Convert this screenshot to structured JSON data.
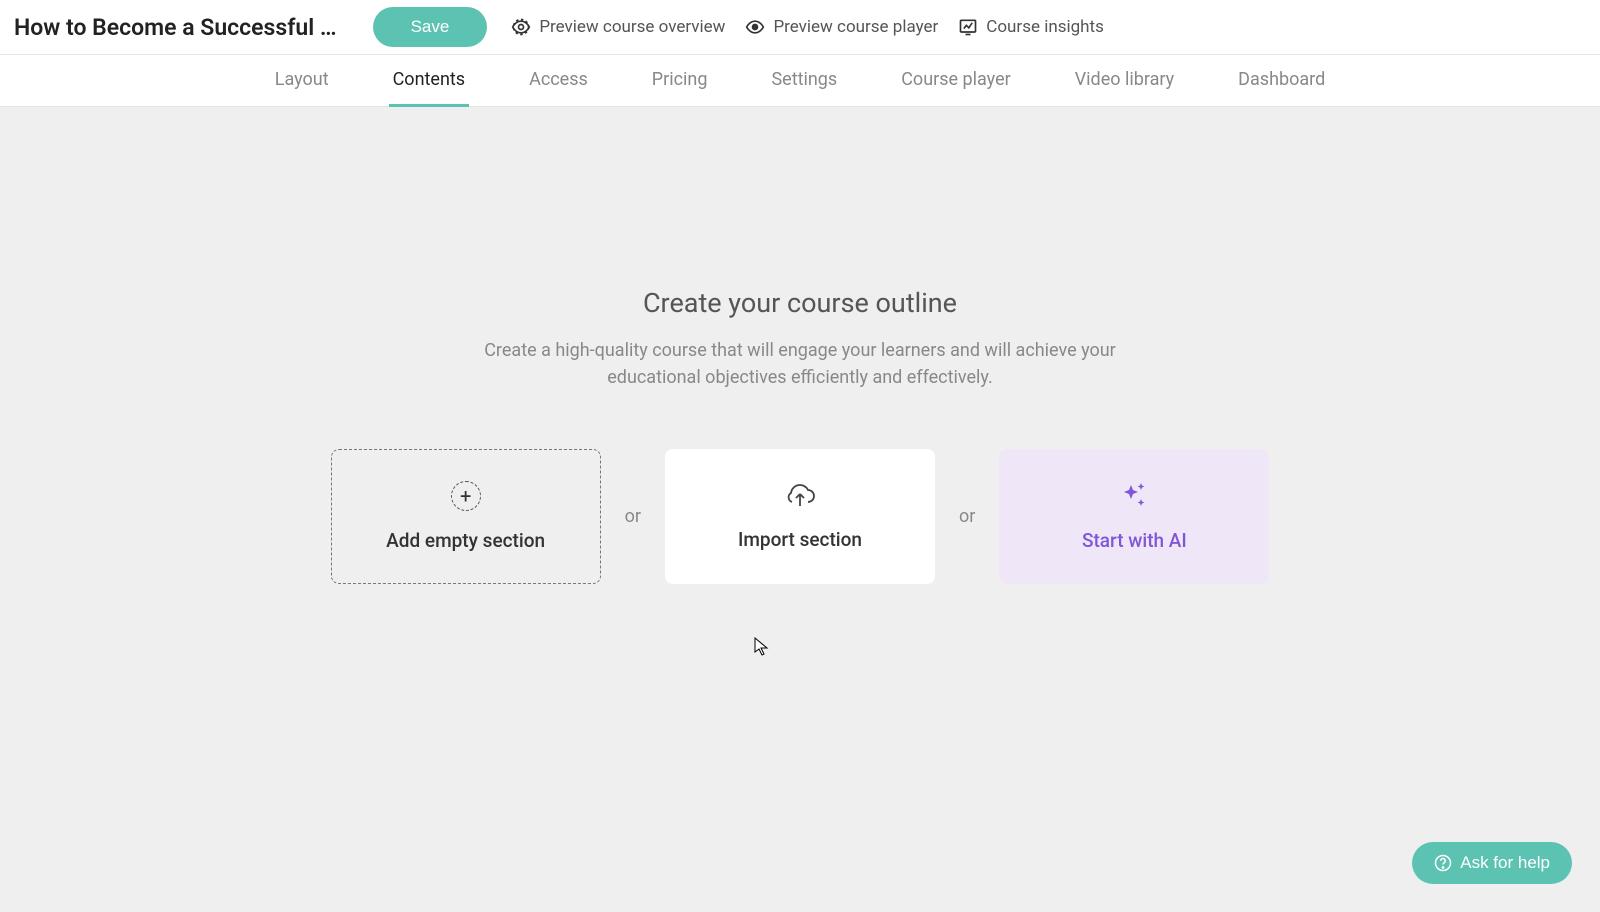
{
  "header": {
    "course_title": "How to Become a Successful …",
    "save_label": "Save",
    "links": {
      "preview_overview": "Preview course overview",
      "preview_player": "Preview course player",
      "course_insights": "Course insights"
    }
  },
  "tabs": {
    "layout": "Layout",
    "contents": "Contents",
    "access": "Access",
    "pricing": "Pricing",
    "settings": "Settings",
    "course_player": "Course player",
    "video_library": "Video library",
    "dashboard": "Dashboard"
  },
  "main": {
    "heading": "Create your course outline",
    "subtext": "Create a high-quality course that will engage your learners and will achieve your educational objectives efficiently and effectively.",
    "or_text": "or",
    "options": {
      "add_empty": "Add empty section",
      "import_section": "Import section",
      "start_ai": "Start with AI"
    }
  },
  "help": {
    "ask_label": "Ask for help"
  }
}
